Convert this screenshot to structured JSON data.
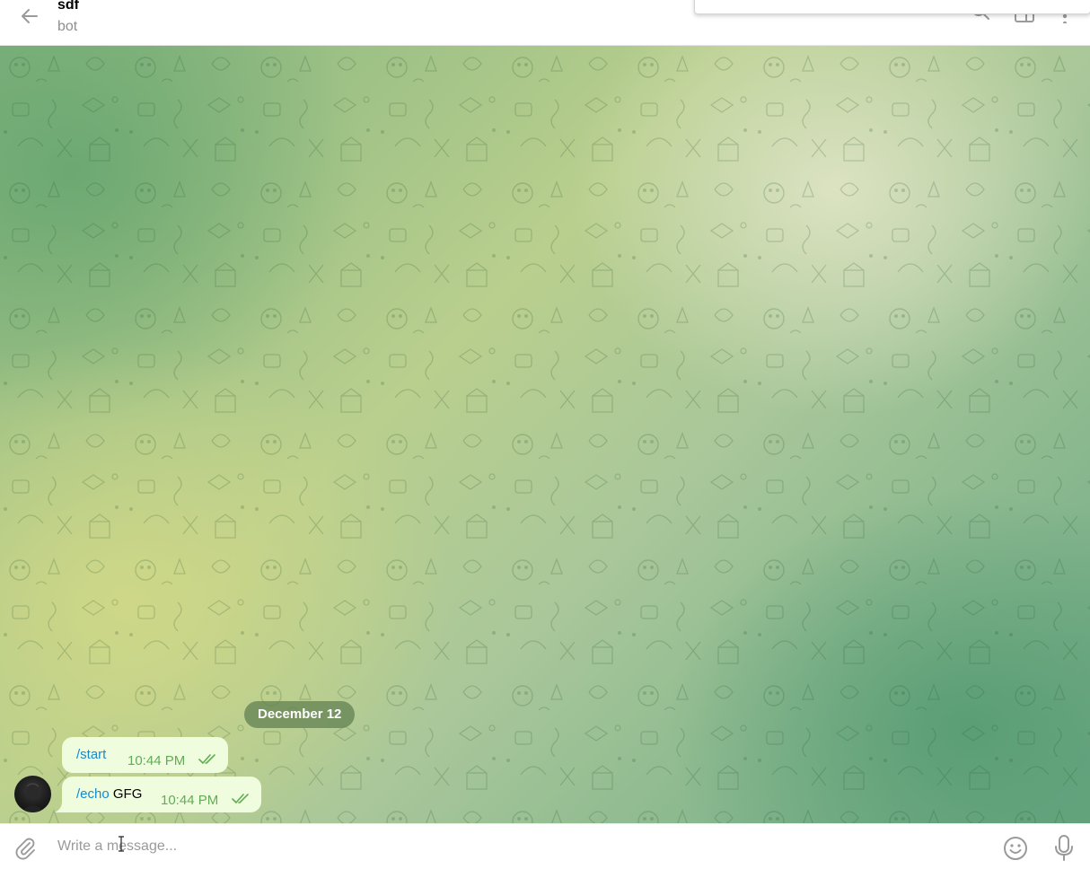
{
  "header": {
    "title": "sdf",
    "subtitle": "bot"
  },
  "chat": {
    "date_separator": "December 12",
    "messages": [
      {
        "command": "/start",
        "text": "",
        "time": "10:44 PM",
        "status": "read"
      },
      {
        "command": "/echo",
        "text": " GFG",
        "time": "10:44 PM",
        "status": "read"
      }
    ]
  },
  "composer": {
    "placeholder": "Write a message..."
  },
  "icons": {
    "back": "back-arrow-icon",
    "search": "search-icon",
    "sidebar": "sidebar-toggle-icon",
    "more": "more-vertical-icon",
    "attach": "paperclip-icon",
    "emoji": "emoji-icon",
    "voice": "microphone-icon",
    "read_receipt": "double-check-icon"
  },
  "colors": {
    "accent_link": "#168acd",
    "outgoing_bubble": "#effdde",
    "read_check": "#62ac55",
    "date_pill": "#628052"
  }
}
